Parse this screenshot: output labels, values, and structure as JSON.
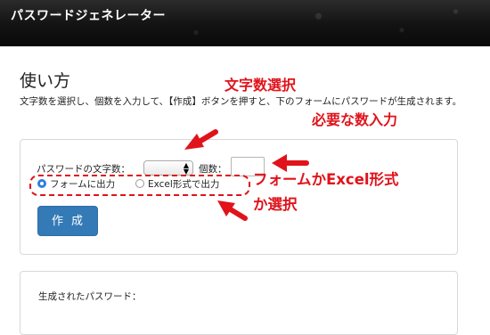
{
  "header": {
    "title": "パスワードジェネレーター"
  },
  "section": {
    "title": "使い方",
    "description": "文字数を選択し、個数を入力して、【作成】ボタンを押すと、下のフォームにパスワードが生成されます。"
  },
  "form": {
    "length_label": "パスワードの文字数：",
    "length_value": "",
    "count_label": "個数：",
    "count_value": "",
    "radio_form_label": "フォームに出力",
    "radio_form_checked": true,
    "radio_excel_label": "Excel形式で出力",
    "radio_excel_checked": false,
    "create_button": "作成"
  },
  "output": {
    "label": "生成されたパスワード："
  },
  "annotations": {
    "length_select": "文字数選択",
    "count_input": "必要な数入力",
    "output_format_line1": "フォームかExcel形式",
    "output_format_line2": "か選択",
    "color": "#e0131b"
  },
  "colors": {
    "button": "#337ab7",
    "radio_accent": "#2d7fe0",
    "header_bg": "#1a1a1a"
  }
}
